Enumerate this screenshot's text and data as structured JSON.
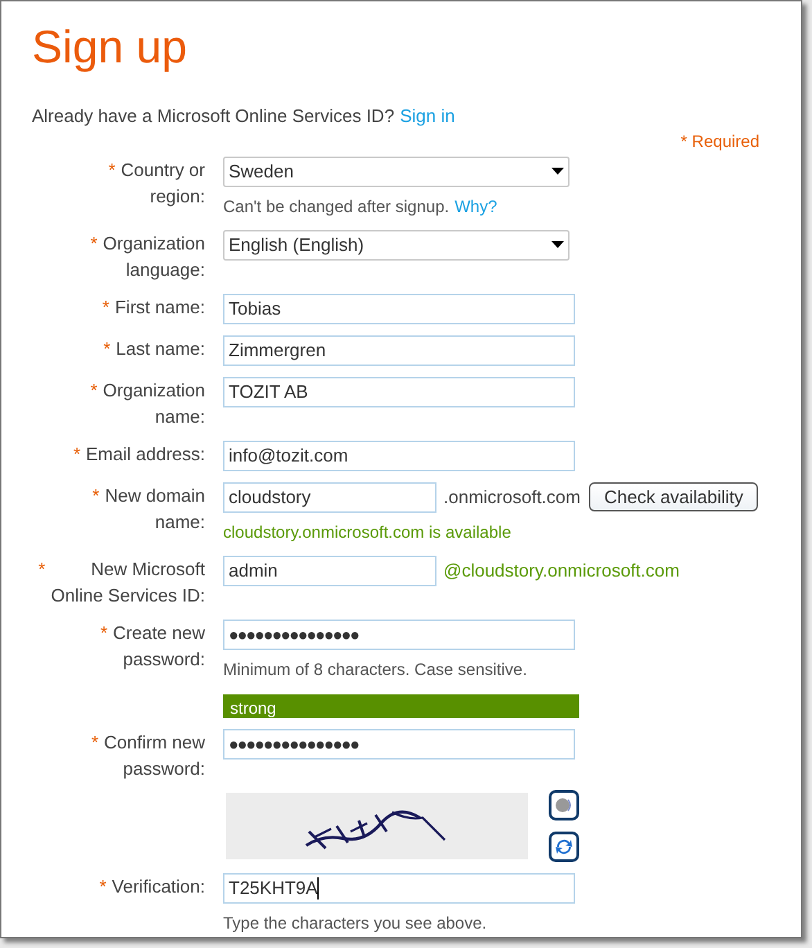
{
  "title": "Sign up",
  "signin_prompt": {
    "text": "Already have a Microsoft Online Services ID?",
    "link": "Sign in"
  },
  "required_note": "* Required",
  "fields": [
    {
      "kind": "select",
      "marker": "*",
      "label": "Country or\nregion:",
      "value": "Sweden",
      "hint": {
        "text": "Can't be changed after signup.",
        "link": "Why?",
        "color": "#555555"
      }
    },
    {
      "kind": "select",
      "marker": "*",
      "label": "Organization\nlanguage:",
      "value": "English (English)"
    },
    {
      "kind": "text",
      "marker": "*",
      "label": "First name:",
      "value": "Tobias"
    },
    {
      "kind": "text",
      "marker": "*",
      "label": "Last name:",
      "value": "Zimmergren"
    },
    {
      "kind": "text",
      "marker": "*",
      "label": "Organization\nname:",
      "value": "TOZIT AB"
    },
    {
      "kind": "text",
      "marker": "*",
      "label": "Email address:",
      "value": "info@tozit.com"
    },
    {
      "kind": "short",
      "marker": "*",
      "label": "New domain\nname:",
      "value": "cloudstory",
      "suffix": {
        "text": ".onmicrosoft.com",
        "color": "#444444"
      },
      "button": "Check availability",
      "hint": {
        "text": "cloudstory.onmicrosoft.com is available",
        "color": "#5a9a08"
      }
    },
    {
      "kind": "short",
      "marker": "*",
      "label": "New Microsoft\nOnline Services ID:",
      "value": "admin",
      "suffix": {
        "text": "@cloudstory.onmicrosoft.com",
        "color": "#5a9a08"
      }
    },
    {
      "kind": "password",
      "marker": "*",
      "label": "Create new\npassword:",
      "value": "●●●●●●●●●●●●●●●",
      "hint": {
        "text": "Minimum of 8 characters. Case sensitive.",
        "color": "#555555"
      },
      "strength": {
        "label": "strong",
        "level": 1
      }
    },
    {
      "kind": "password",
      "marker": "*",
      "label": "Confirm new\npassword:",
      "value": "●●●●●●●●●●●●●●●"
    },
    {
      "kind": "captcha"
    },
    {
      "kind": "text",
      "marker": "*",
      "label": "Verification:",
      "value": "T25KHT9A",
      "focused": true,
      "hint": {
        "text": "Type the characters you see above.",
        "color": "#555555"
      }
    }
  ]
}
